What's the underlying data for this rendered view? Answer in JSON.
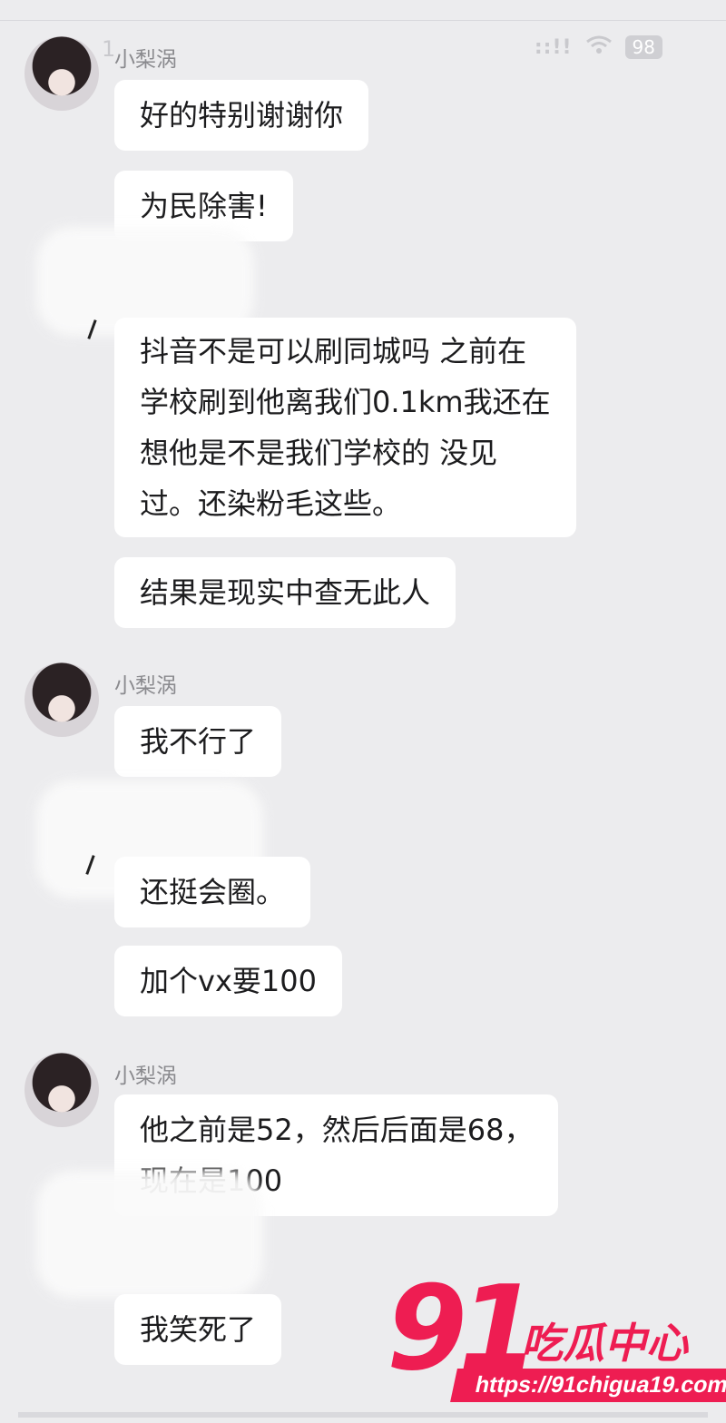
{
  "status_bar": {
    "time": "1",
    "signal": "::!!",
    "battery": "98"
  },
  "groups": [
    {
      "sender": "小梨涡",
      "messages": [
        "好的特别谢谢你",
        "为民除害!",
        "抖音不是可以刷同城吗 之前在\n学校刷到他离我们0.1km我还在\n想他是不是我们学校的 没见\n过。还染粉毛这些。",
        "结果是现实中查无此人"
      ]
    },
    {
      "sender": "小梨涡",
      "messages": [
        "我不行了",
        "还挺会圈。",
        "加个vx要100"
      ]
    },
    {
      "sender": "小梨涡",
      "messages": [
        "他之前是52，然后后面是68，\n现在是100",
        "我笑死了"
      ]
    }
  ],
  "watermark": {
    "logo": "91",
    "title": "吃瓜中心",
    "url": "https://91chigua19.com"
  },
  "colors": {
    "background": "#ececee",
    "bubble": "#ffffff",
    "watermark": "#ee1d52"
  }
}
